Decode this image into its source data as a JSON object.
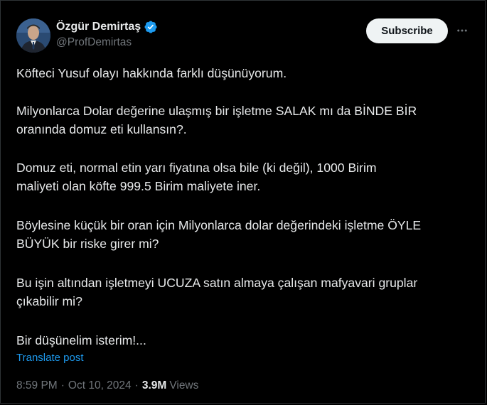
{
  "author": {
    "name": "Özgür Demirtaş",
    "handle": "@ProfDemirtas",
    "verified_icon": "verified-badge-icon",
    "avatar_icon": "profile-photo"
  },
  "header": {
    "subscribe_label": "Subscribe",
    "more_icon": "more-options-icon"
  },
  "post": {
    "paragraphs": [
      "Köfteci Yusuf olayı hakkında farklı düşünüyorum.",
      "Milyonlarca Dolar değerine ulaşmış bir işletme SALAK mı da BİNDE BİR\noranında domuz eti kullansın?.",
      "Domuz eti, normal etin yarı fiyatına olsa bile (ki değil), 1000 Birim\nmaliyeti olan köfte 999.5 Birim maliyete iner.",
      "Böylesine küçük bir oran için Milyonlarca dolar değerindeki işletme ÖYLE\nBÜYÜK bir riske girer mi?",
      "Bu işin altından işletmeyi UCUZA satın almaya çalışan mafyavari gruplar\nçıkabilir mi?",
      "Bir düşünelim isterim!..."
    ],
    "translate_label": "Translate post",
    "time": "8:59 PM",
    "date": "Oct 10, 2024",
    "dot": "·",
    "views_count": "3.9M",
    "views_label": "Views"
  },
  "colors": {
    "background": "#000000",
    "text": "#e7e9ea",
    "muted": "#71767b",
    "link": "#1d9bf0",
    "verified": "#1d9bf0"
  }
}
